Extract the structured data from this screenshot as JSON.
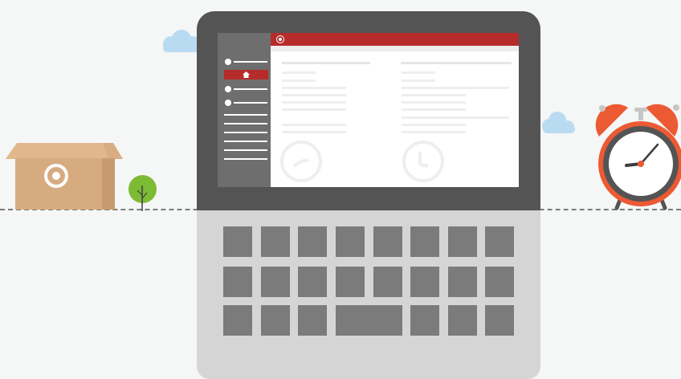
{
  "scene": {
    "description_free": true
  },
  "colors": {
    "background": "#f5f6f6",
    "laptop_lid": "#545455",
    "laptop_base": "#d6d5d5",
    "key": "#7b7b7b",
    "accent": "#b62c2b",
    "sidebar": "#6e6e6e",
    "cloud": "#b9dbf2",
    "box": "#d7ab80",
    "tree": "#7dbb34",
    "clock": "#ec5a33"
  },
  "icons": {
    "brand": "target-logo-icon",
    "nav_home": "home-icon",
    "box_logo": "target-logo-icon",
    "clock": "alarm-clock-icon",
    "tree": "tree-icon",
    "cloud": "cloud-icon"
  },
  "keyboard": {
    "rows": [
      [
        1,
        1,
        1,
        1,
        1,
        1,
        1,
        1
      ],
      [
        1,
        1,
        1,
        1,
        1,
        1,
        1,
        1
      ],
      [
        1,
        1,
        1,
        2,
        1,
        1,
        1
      ]
    ]
  }
}
